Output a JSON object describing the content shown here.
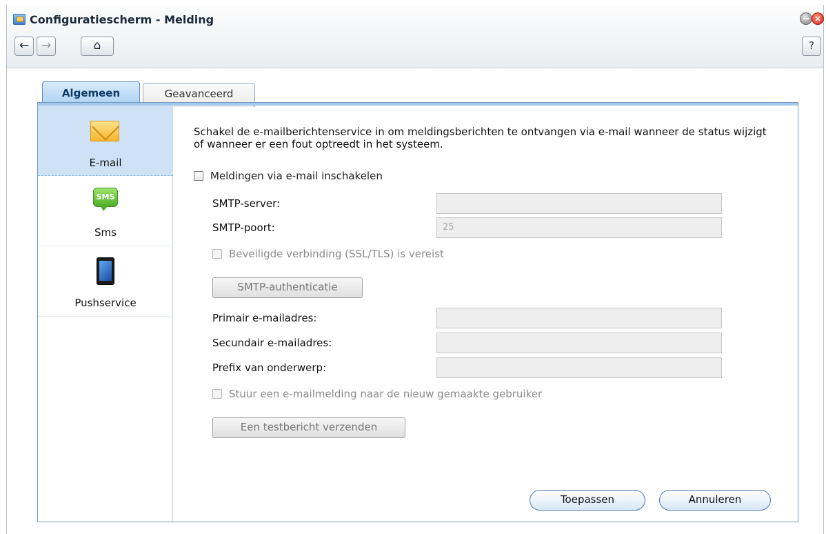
{
  "window": {
    "title": "Configuratiescherm - Melding",
    "icon": "control-panel-icon",
    "close_glyph": "×",
    "help_label": "?"
  },
  "nav": {
    "back_glyph": "←",
    "forward_glyph": "→",
    "home_glyph": "⌂"
  },
  "tabs": [
    {
      "label": "Algemeen",
      "active": true
    },
    {
      "label": "Geavanceerd",
      "active": false
    }
  ],
  "sidebar": {
    "items": [
      {
        "label": "E-mail",
        "icon": "envelope-icon",
        "selected": true
      },
      {
        "label": "Sms",
        "icon": "sms-icon",
        "icon_text": "SMS",
        "selected": false
      },
      {
        "label": "Pushservice",
        "icon": "phone-icon",
        "selected": false
      }
    ]
  },
  "email": {
    "description": "Schakel de e-mailberichtenservice in om meldingsberichten te ontvangen via e-mail wanneer de status wijzigt of wanneer er een fout optreedt in het systeem.",
    "enable_label": "Meldingen via e-mail inschakelen",
    "enable_checked": false,
    "smtp_server_label": "SMTP-server:",
    "smtp_server_value": "",
    "smtp_port_label": "SMTP-poort:",
    "smtp_port_value": "25",
    "ssl_label": "Beveiligde verbinding (SSL/TLS) is vereist",
    "ssl_checked": false,
    "auth_button": "SMTP-authenticatie",
    "primary_label": "Primair e-mailadres:",
    "primary_value": "",
    "secondary_label": "Secundair e-mailadres:",
    "secondary_value": "",
    "prefix_label": "Prefix van onderwerp:",
    "prefix_value": "",
    "notify_new_user_label": "Stuur een e-mailmelding naar de nieuw gemaakte gebruiker",
    "notify_new_user_checked": false,
    "test_button": "Een testbericht verzenden"
  },
  "footer": {
    "apply": "Toepassen",
    "cancel": "Annuleren"
  }
}
